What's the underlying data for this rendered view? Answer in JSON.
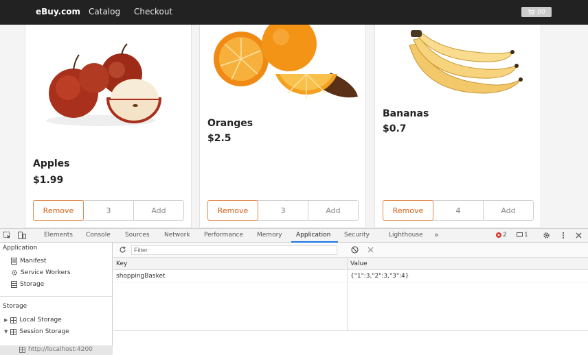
{
  "nav": {
    "brand": "eBuy.com",
    "links": [
      "Catalog",
      "Checkout"
    ],
    "cart_icon": "cart-icon",
    "cart_count": "00"
  },
  "products": [
    {
      "name": "Apples",
      "price": "$1.99",
      "remove": "Remove",
      "qty": "3",
      "add": "Add"
    },
    {
      "name": "Oranges",
      "price": "$2.5",
      "remove": "Remove",
      "qty": "3",
      "add": "Add"
    },
    {
      "name": "Bananas",
      "price": "$0.7",
      "remove": "Remove",
      "qty": "4",
      "add": "Add"
    }
  ],
  "devtools": {
    "tabs": [
      "Elements",
      "Console",
      "Sources",
      "Network",
      "Performance",
      "Memory",
      "Application",
      "Security",
      "Lighthouse"
    ],
    "active_tab": "Application",
    "more": "»",
    "errors": "2",
    "messages": "1",
    "sidebar": {
      "app_heading": "Application",
      "app_items": [
        "Manifest",
        "Service Workers",
        "Storage"
      ],
      "storage_heading": "Storage",
      "storage_items": [
        "Local Storage",
        "Session Storage"
      ],
      "session_child": "http://localhost:4200"
    },
    "filter_placeholder": "Filter",
    "columns": {
      "key": "Key",
      "value": "Value"
    },
    "rows": [
      {
        "key": "shoppingBasket",
        "value": "{\"1\":3,\"2\":3,\"3\":4}"
      }
    ]
  },
  "colors": {
    "navbar": "#222222",
    "accent_orange": "#d35f16",
    "devtools_blue": "#1a73e8",
    "error_red": "#d93025"
  }
}
